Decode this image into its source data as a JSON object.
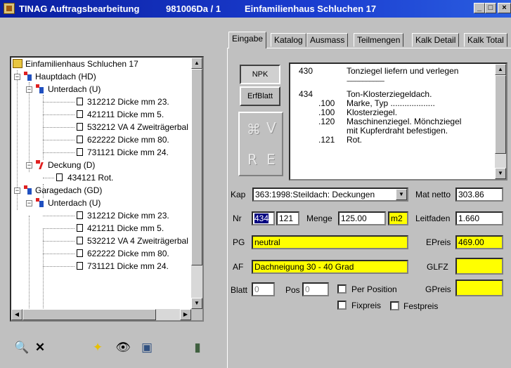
{
  "window": {
    "app_title": "TINAG Auftragsbearbeitung",
    "doc_number": "981006Da / 1",
    "project": "Einfamilienhaus Schluchen 17",
    "buttons": {
      "minimize": "_",
      "maximize": "□",
      "close": "×"
    }
  },
  "tree": {
    "root": "Einfamilienhaus Schluchen 17",
    "items": [
      {
        "label": "Hauptdach (HD)"
      },
      {
        "label": "Unterdach (U)"
      },
      {
        "label": "312212 Dicke mm 23."
      },
      {
        "label": "421211 Dicke mm 5."
      },
      {
        "label": "532212 VA 4 Zweiträgerbal"
      },
      {
        "label": "622222 Dicke mm 80."
      },
      {
        "label": "731121 Dicke mm 24."
      },
      {
        "label": "Deckung (D)"
      },
      {
        "label": "434121 Rot."
      },
      {
        "label": "Garagedach (GD)"
      },
      {
        "label": "Unterdach (U)"
      },
      {
        "label": "312212 Dicke mm 23."
      },
      {
        "label": "421211 Dicke mm 5."
      },
      {
        "label": "532212 VA 4 Zweiträgerbal"
      },
      {
        "label": "622222 Dicke mm 80."
      },
      {
        "label": "731121 Dicke mm 24."
      }
    ]
  },
  "toolbar": {
    "icons": [
      "search-icon",
      "delete-icon",
      "sparkle-icon",
      "binoculars-icon",
      "picture-icon",
      "exit-door-icon"
    ],
    "glyphs": {
      "search": "🔍",
      "delete": "✕",
      "sparkle": "✦",
      "binoculars": "👁",
      "picture": "▣",
      "exit": "▮"
    }
  },
  "tabs": [
    "Eingabe",
    "Katalog",
    "Ausmass",
    "Teilmengen",
    "Kalk Detail",
    "Kalk Total"
  ],
  "side_buttons": {
    "npk": "NPK",
    "erfblatt": "ErfBlatt",
    "letters": [
      "V",
      "R",
      "E"
    ]
  },
  "text_list": [
    {
      "code": "430",
      "text": "Tonziegel liefern und verlegen"
    },
    {
      "code": "",
      "text": "--------------------------------"
    },
    {
      "code": "434",
      "text": "Ton-Klosterziegeldach."
    },
    {
      "code": ".100",
      "text": "Marke, Typ ..................."
    },
    {
      "code": ".100",
      "text": "Klosterziegel."
    },
    {
      "code": ".120",
      "text": "Maschinenziegel. Mönchziegel"
    },
    {
      "code": "",
      "text": "mit Kupferdraht befestigen."
    },
    {
      "code": ".121",
      "text": "Rot."
    }
  ],
  "form": {
    "kap_label": "Kap",
    "kap_value": "363:1998:Steildach: Deckungen",
    "mat_netto_label": "Mat netto",
    "mat_netto_value": "303.86",
    "nr_label": "Nr",
    "nr_value1": "434",
    "nr_value2": "121",
    "menge_label": "Menge",
    "menge_value": "125.00",
    "unit_value": "m2",
    "leitfaden_label": "Leitfaden",
    "leitfaden_value": "1.660",
    "pg_label": "PG",
    "pg_value": "neutral",
    "epreis_label": "EPreis",
    "epreis_value": "469.00",
    "af_label": "AF",
    "af_value": "Dachneigung 30 - 40 Grad",
    "glfz_label": "GLFZ",
    "glfz_value": "",
    "blatt_label": "Blatt",
    "blatt_value": "0",
    "pos_label": "Pos",
    "pos_value": "0",
    "per_position_label": "Per Position",
    "gpreis_label": "GPreis",
    "gpreis_value": "",
    "fixpreis_label": "Fixpreis",
    "festpreis_label": "Festpreis"
  },
  "colors": {
    "title_bar": "#0a1fa0",
    "highlight": "#ffff00",
    "selection": "#000080"
  }
}
